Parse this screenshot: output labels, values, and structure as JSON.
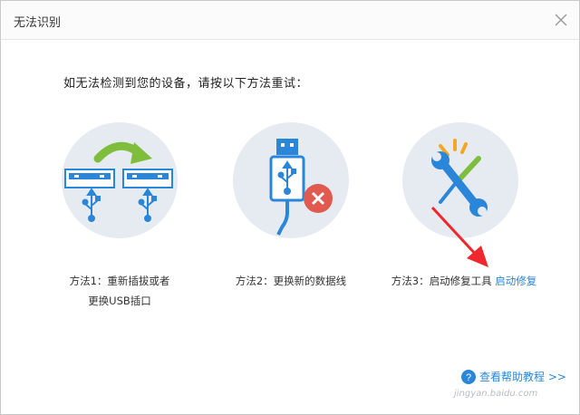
{
  "window": {
    "title": "无法识别"
  },
  "instruction": "如无法检测到您的设备，请按以下方法重试：",
  "methods": [
    {
      "line1": "方法1：重新插拔或者",
      "line2": "更换USB插口",
      "icon": "usb-replug-icon"
    },
    {
      "line1": "方法2：更换新的数据线",
      "icon": "usb-cable-error-icon"
    },
    {
      "line1": "方法3：启动修复工具",
      "link": "启动修复",
      "icon": "repair-tools-icon"
    }
  ],
  "help_link": {
    "label": "查看帮助教程 >>",
    "icon": "help-icon"
  },
  "watermark": "jingyan.baidu.com",
  "colors": {
    "circle_bg": "#e6ebf2",
    "usb_blue": "#2a86d8",
    "arrow_green": "#7fbe3c",
    "error_red": "#e05a4f",
    "annotation_red": "#f0282d"
  }
}
